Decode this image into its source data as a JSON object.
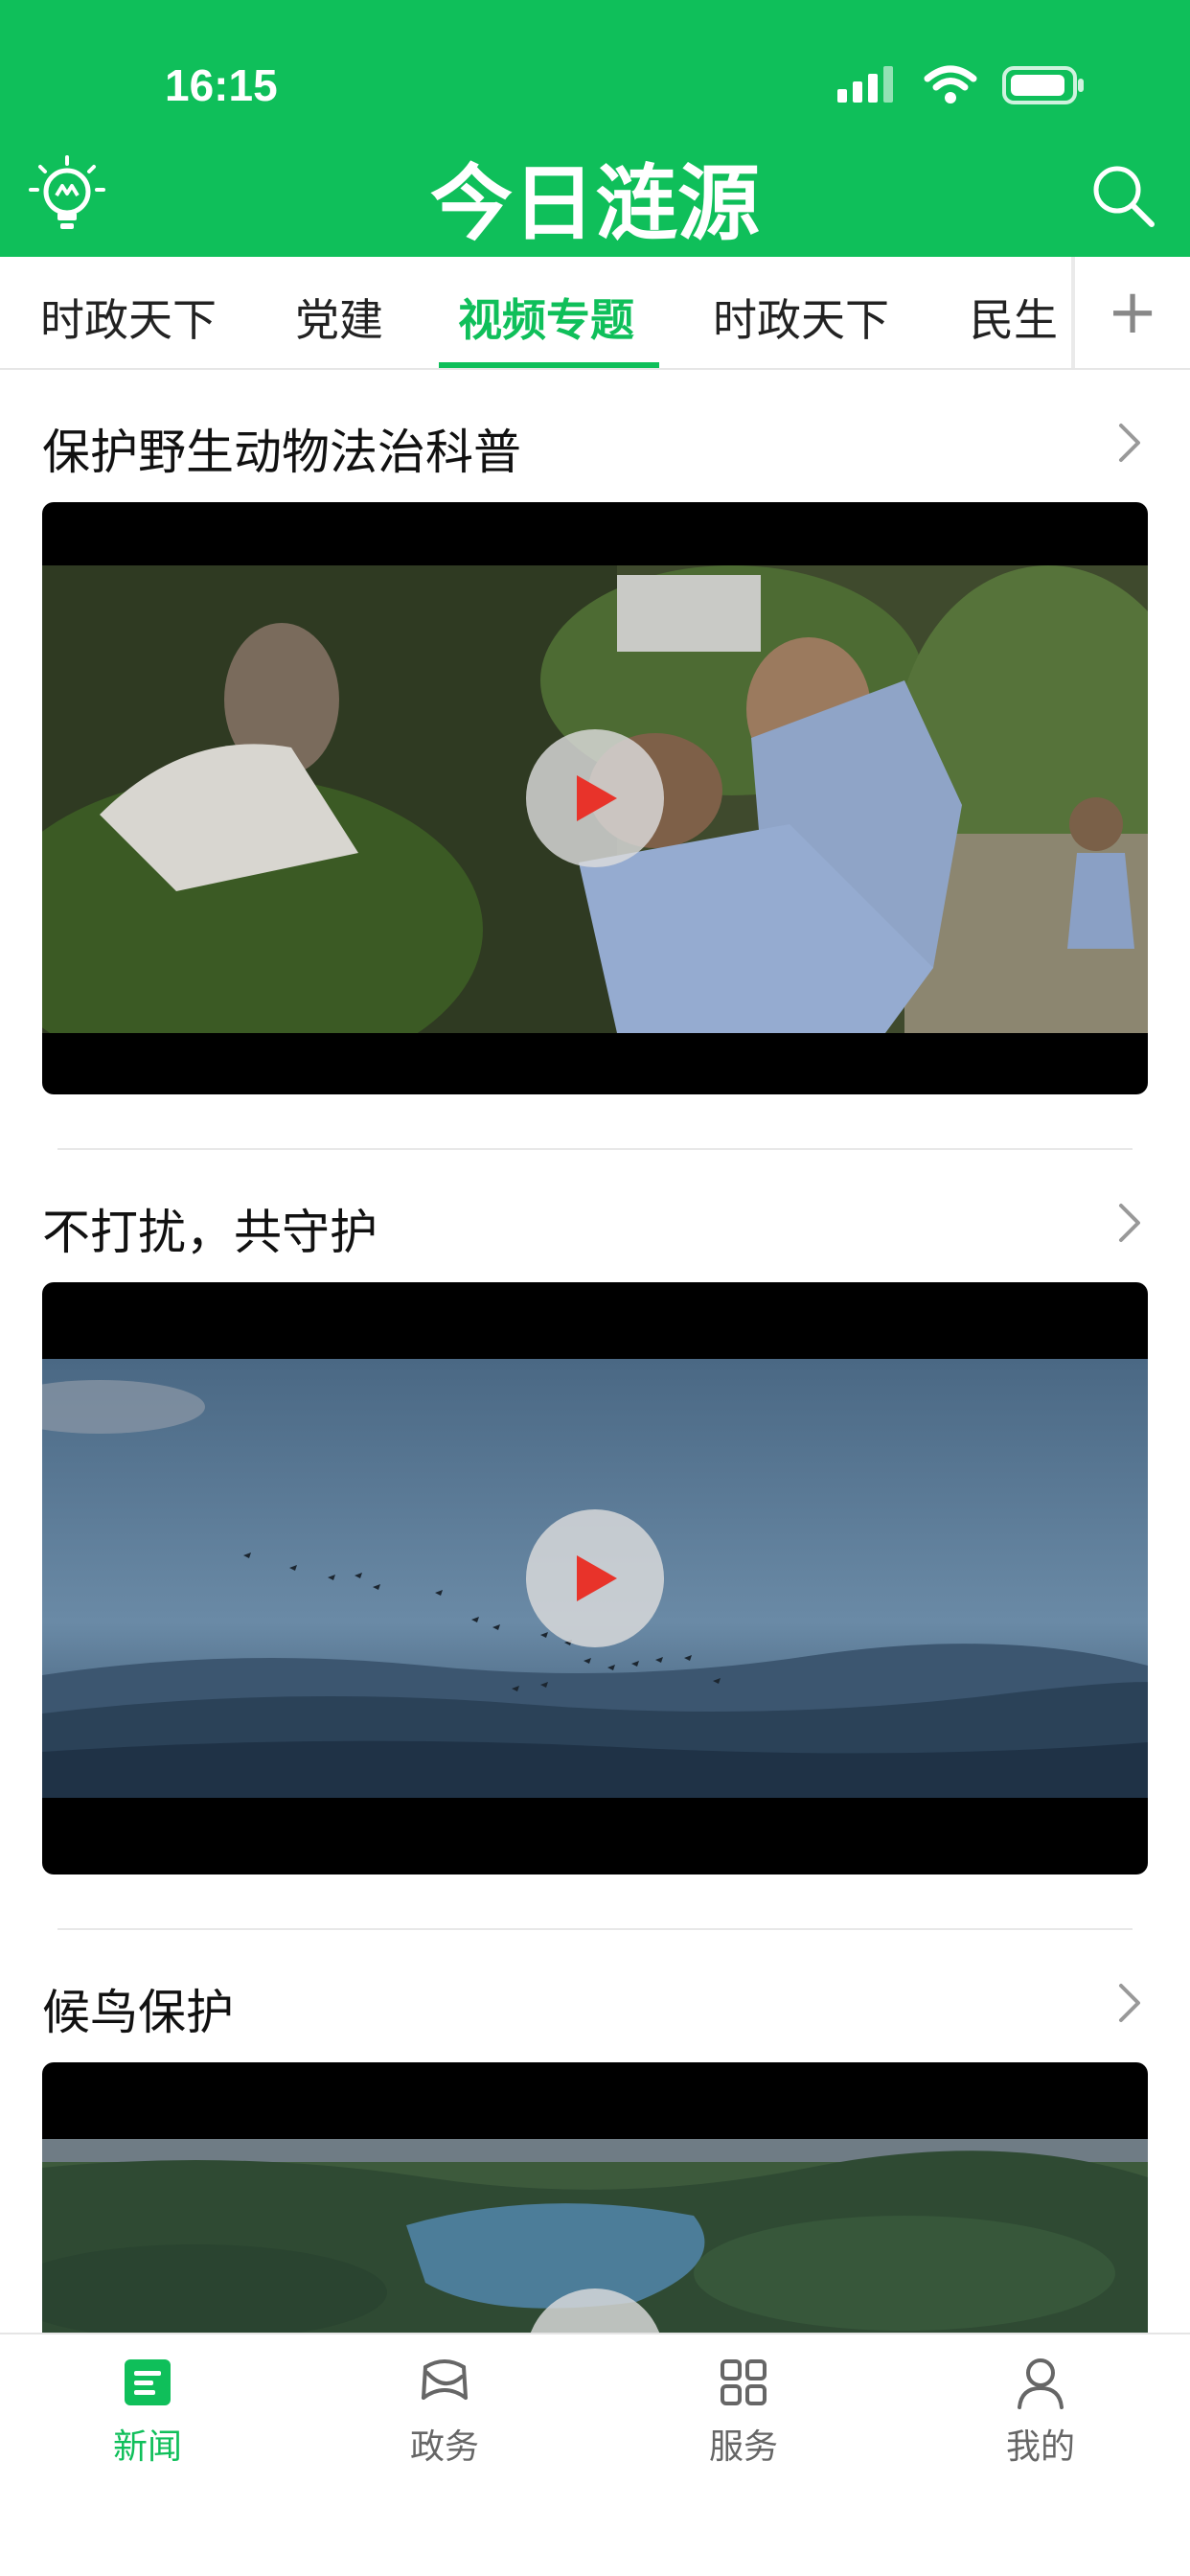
{
  "status_bar": {
    "time": "16:15"
  },
  "header": {
    "title": "今日涟源",
    "bulb_icon": "lightbulb-icon",
    "search_icon": "search-icon"
  },
  "tabs": [
    {
      "label": "时政天下",
      "active": false
    },
    {
      "label": "党建",
      "active": false
    },
    {
      "label": "视频专题",
      "active": true
    },
    {
      "label": "时政天下",
      "active": false
    },
    {
      "label": "民生",
      "active": false
    }
  ],
  "sections": [
    {
      "title": "保护野生动物法治科普"
    },
    {
      "title": "不打扰，共守护"
    },
    {
      "title": "候鸟保护"
    }
  ],
  "bottom_nav": [
    {
      "label": "新闻",
      "icon": "news-icon",
      "active": true
    },
    {
      "label": "政务",
      "icon": "government-icon",
      "active": false
    },
    {
      "label": "服务",
      "icon": "services-grid-icon",
      "active": false
    },
    {
      "label": "我的",
      "icon": "profile-icon",
      "active": false
    }
  ],
  "colors": {
    "brand_green": "#0fbf5a",
    "play_red": "#e8332a"
  }
}
